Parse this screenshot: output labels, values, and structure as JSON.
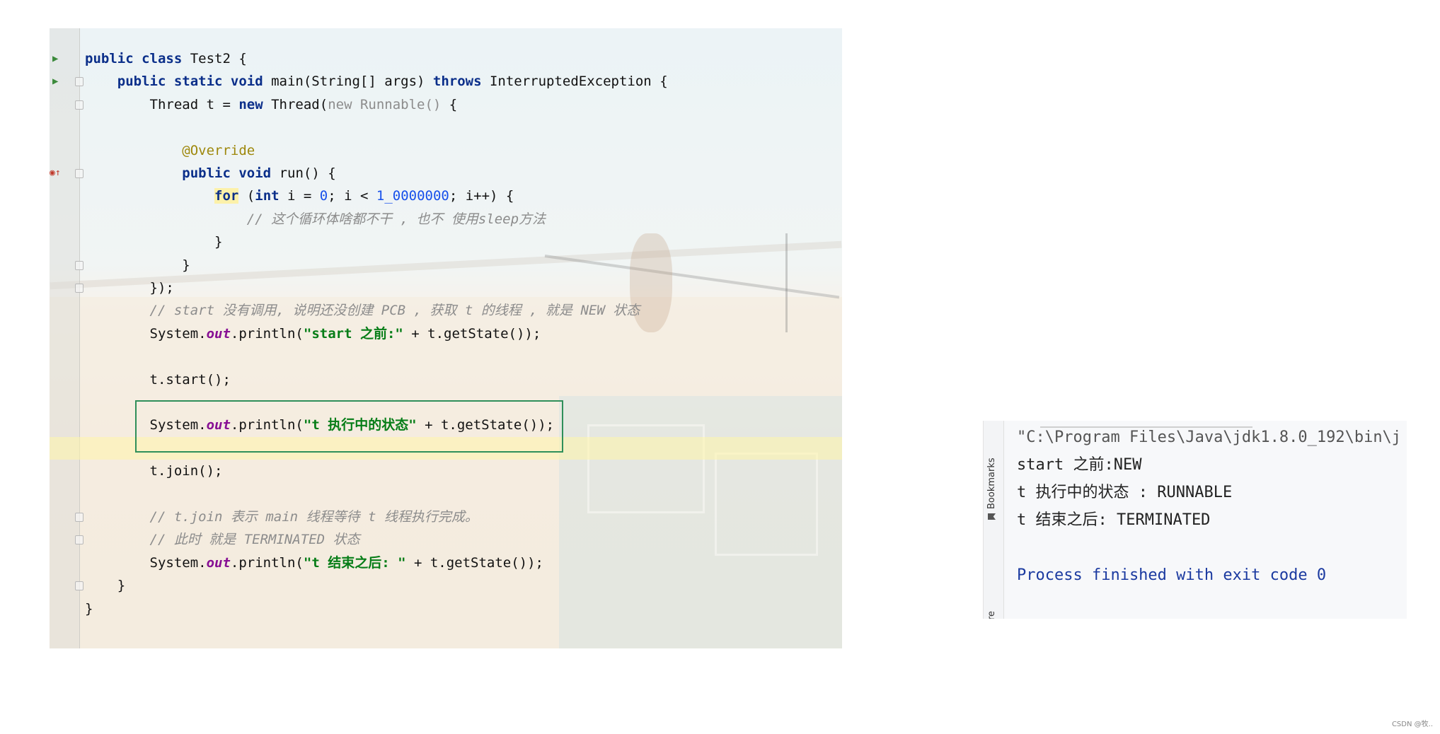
{
  "editor": {
    "lines": [
      {
        "html": "<span class=\"kw\">public class</span> Test2 {",
        "run": true
      },
      {
        "html": "    <span class=\"kw\">public static void</span> main(String[] args) <span class=\"kw\">throws</span> InterruptedException {",
        "run": true,
        "fold": true
      },
      {
        "html": "        Thread t = <span class=\"kw\">new</span> Thread(<span class=\"gray\">new Runnable()</span> {",
        "fold": true
      },
      {
        "html": ""
      },
      {
        "html": "            <span class=\"ann\">@Override</span>"
      },
      {
        "html": "            <span class=\"kw\">public void</span> run() {",
        "override": true,
        "fold": true
      },
      {
        "html": "                <span class=\"kw cursor-bg\">for</span> (<span class=\"kw\">int</span> i = <span class=\"num\">0</span>; i &lt; <span class=\"num\">1_0000000</span>; i++) {"
      },
      {
        "html": "                    <span class=\"cmt\">// 这个循环体啥都不干 , 也不 使用sleep方法</span>"
      },
      {
        "html": "                }"
      },
      {
        "html": "            }",
        "fold": true
      },
      {
        "html": "        });",
        "fold": true
      },
      {
        "html": "        <span class=\"cmt\">// start 没有调用, 说明还没创建 PCB , 获取 t 的线程 , 就是 NEW 状态</span>"
      },
      {
        "html": "        System.<span class=\"fld\">out</span>.println(<span class=\"str\">\"start 之前:\"</span> + t.getState());"
      },
      {
        "html": ""
      },
      {
        "html": "        t.start();"
      },
      {
        "html": ""
      },
      {
        "html": "        System.<span class=\"fld\">out</span>.println(<span class=\"str\">\"t 执行中的状态\"</span> + t.getState());"
      },
      {
        "html": "",
        "highlight": true
      },
      {
        "html": "        t.join();"
      },
      {
        "html": ""
      },
      {
        "html": "        <span class=\"cmt\">// t.join 表示 main 线程等待 t 线程执行完成。</span>",
        "fold": true
      },
      {
        "html": "        <span class=\"cmt\">// 此时 就是 TERMINATED 状态</span>",
        "fold": true
      },
      {
        "html": "        System.<span class=\"fld\">out</span>.println(<span class=\"str\">\"t 结束之后: \"</span> + t.getState());"
      },
      {
        "html": "    }",
        "fold": true
      },
      {
        "html": "}"
      }
    ]
  },
  "console": {
    "side_label_bookmarks": "Bookmarks",
    "side_label_re": "re",
    "cmd_line": "\"C:\\Program Files\\Java\\jdk1.8.0_192\\bin\\j",
    "out1": "start 之前:NEW",
    "out2": "t 执行中的状态 : RUNNABLE",
    "out3": "t 结束之后: TERMINATED",
    "finished": "Process finished with exit code 0"
  },
  "watermark": "CSDN @牧.."
}
